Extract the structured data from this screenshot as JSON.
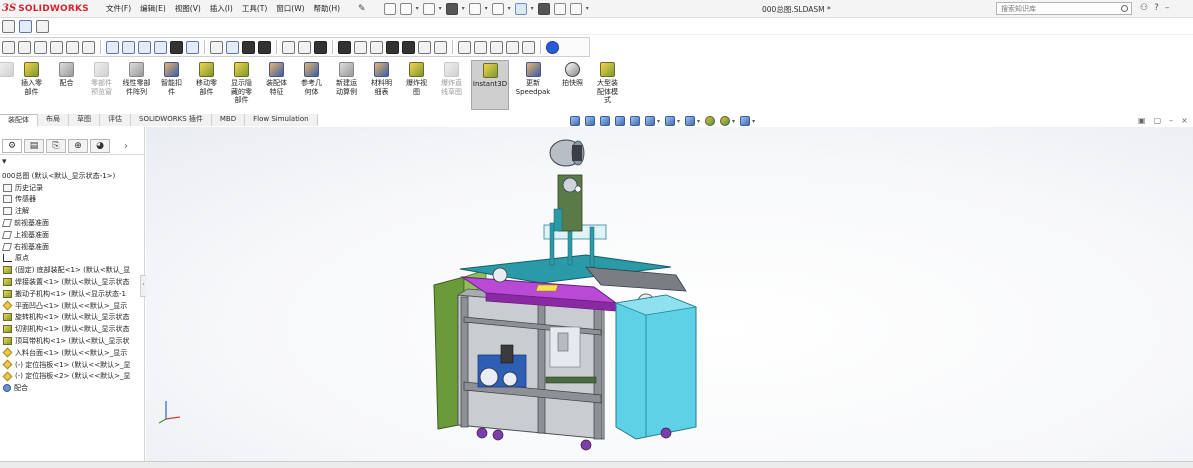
{
  "app": {
    "logo_prefix": "3S",
    "logo_name": "SOLIDWORKS",
    "document_title": "000总图.SLDASM *"
  },
  "menu": [
    "文件(F)",
    "编辑(E)",
    "视图(V)",
    "插入(I)",
    "工具(T)",
    "窗口(W)",
    "帮助(H)"
  ],
  "search": {
    "placeholder": "搜索知识库"
  },
  "command_manager": [
    {
      "label": "插入零\n部件",
      "enabled": true
    },
    {
      "label": "配合",
      "enabled": true
    },
    {
      "label": "零部件\n预览窗",
      "enabled": false
    },
    {
      "label": "线性零部\n件阵列",
      "enabled": true
    },
    {
      "label": "智能扣\n件",
      "enabled": true
    },
    {
      "label": "移动零\n部件",
      "enabled": true
    },
    {
      "label": "显示隐\n藏的零\n部件",
      "enabled": true
    },
    {
      "label": "装配体\n特征",
      "enabled": true
    },
    {
      "label": "参考几\n何体",
      "enabled": true
    },
    {
      "label": "新建运\n动算例",
      "enabled": true
    },
    {
      "label": "材料明\n细表",
      "enabled": true
    },
    {
      "label": "爆炸视\n图",
      "enabled": true
    },
    {
      "label": "爆炸直\n线草图",
      "enabled": false
    },
    {
      "label": "Instant3D",
      "enabled": true,
      "active": true
    },
    {
      "label": "更新\nSpeedpak",
      "enabled": true
    },
    {
      "label": "拍快照",
      "enabled": true
    },
    {
      "label": "大型装\n配体模\n式",
      "enabled": true
    }
  ],
  "tabs": [
    "装配体",
    "布局",
    "草图",
    "评估",
    "SOLIDWORKS 插件",
    "MBD",
    "Flow Simulation"
  ],
  "active_tab": "装配体",
  "feature_tree": {
    "filter_icon": "filter-icon",
    "root": "000总图 (默认<默认_显示状态-1>)",
    "items": [
      {
        "label": "历史记录",
        "icon": "history-icon"
      },
      {
        "label": "传感器",
        "icon": "sensor-icon"
      },
      {
        "label": "注解",
        "icon": "annotation-icon"
      },
      {
        "label": "前视基准面",
        "icon": "plane-icon"
      },
      {
        "label": "上视基准面",
        "icon": "plane-icon"
      },
      {
        "label": "右视基准面",
        "icon": "plane-icon"
      },
      {
        "label": "原点",
        "icon": "origin-icon"
      },
      {
        "label": "(固定) 底部装配<1> (默认<默认_显",
        "icon": "assembly-icon"
      },
      {
        "label": "焊接装置<1> (默认<默认_显示状态",
        "icon": "assembly-icon"
      },
      {
        "label": "搬动子机构<1> (默认<显示状态-1",
        "icon": "assembly-icon"
      },
      {
        "label": "平面凹凸<1> (默认<<默认>_显示",
        "icon": "part-icon"
      },
      {
        "label": "旋转机构<1> (默认<默认_显示状态",
        "icon": "assembly-icon"
      },
      {
        "label": "切割机构<1> (默认<默认_显示状态",
        "icon": "assembly-icon"
      },
      {
        "label": "顶耳带机构<1> (默认<默认_显示状",
        "icon": "assembly-icon"
      },
      {
        "label": "入料台面<1> (默认<<默认>_显示",
        "icon": "part-icon"
      },
      {
        "label": "(-) 定位挡板<1> (默认<<默认>_显",
        "icon": "part-icon"
      },
      {
        "label": "(-) 定位挡板<2> (默认<<默认>_显",
        "icon": "part-icon"
      },
      {
        "label": "配合",
        "icon": "mates-icon"
      }
    ]
  },
  "colors": {
    "brand": "#d0262f",
    "frame_gray": "#8d9196",
    "panel_cyan": "#5fd1e6",
    "panel_green": "#6a9a3a",
    "top_magenta": "#b94ad6",
    "beam_teal": "#2a9aa8"
  }
}
